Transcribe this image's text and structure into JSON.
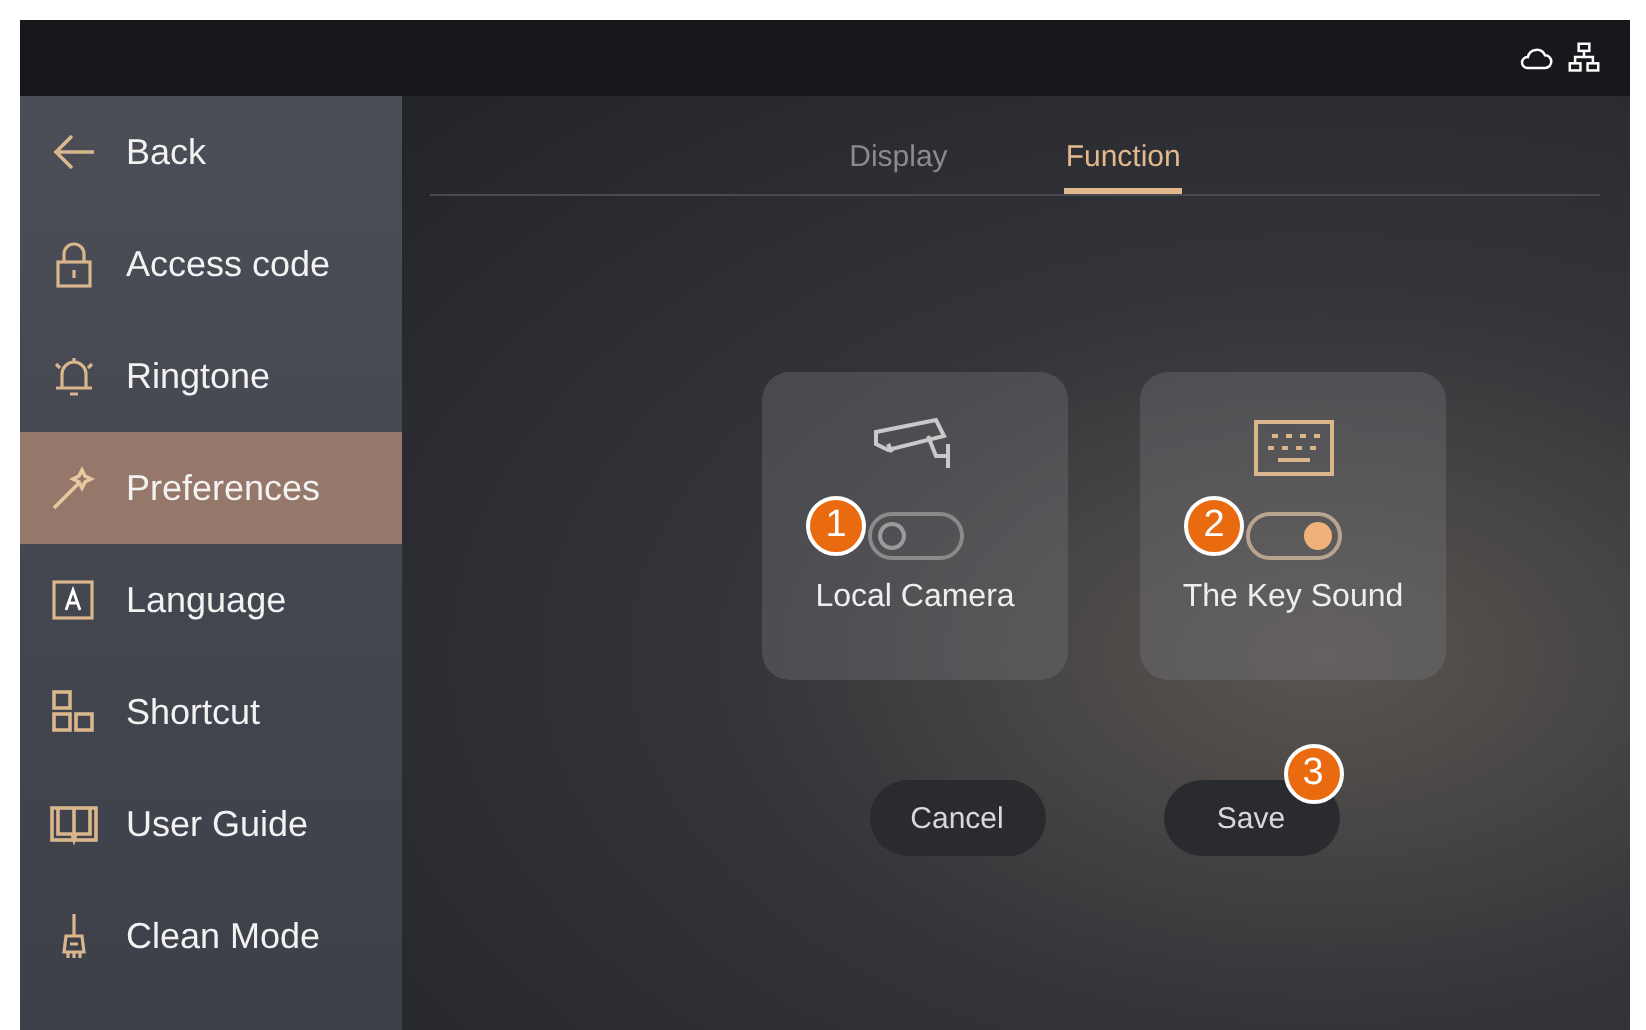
{
  "sidebar": {
    "items": [
      {
        "label": "Back",
        "selected": false
      },
      {
        "label": "Access code",
        "selected": false
      },
      {
        "label": "Ringtone",
        "selected": false
      },
      {
        "label": "Preferences",
        "selected": true
      },
      {
        "label": "Language",
        "selected": false
      },
      {
        "label": "Shortcut",
        "selected": false
      },
      {
        "label": "User Guide",
        "selected": false
      },
      {
        "label": "Clean Mode",
        "selected": false
      }
    ]
  },
  "tabs": [
    {
      "label": "Display",
      "selected": false
    },
    {
      "label": "Function",
      "selected": true
    }
  ],
  "cards": [
    {
      "label": "Local Camera",
      "on": false,
      "callout": "1"
    },
    {
      "label": "The Key Sound",
      "on": true,
      "callout": "2"
    }
  ],
  "buttons": [
    {
      "label": "Cancel"
    },
    {
      "label": "Save",
      "callout": "3"
    }
  ]
}
